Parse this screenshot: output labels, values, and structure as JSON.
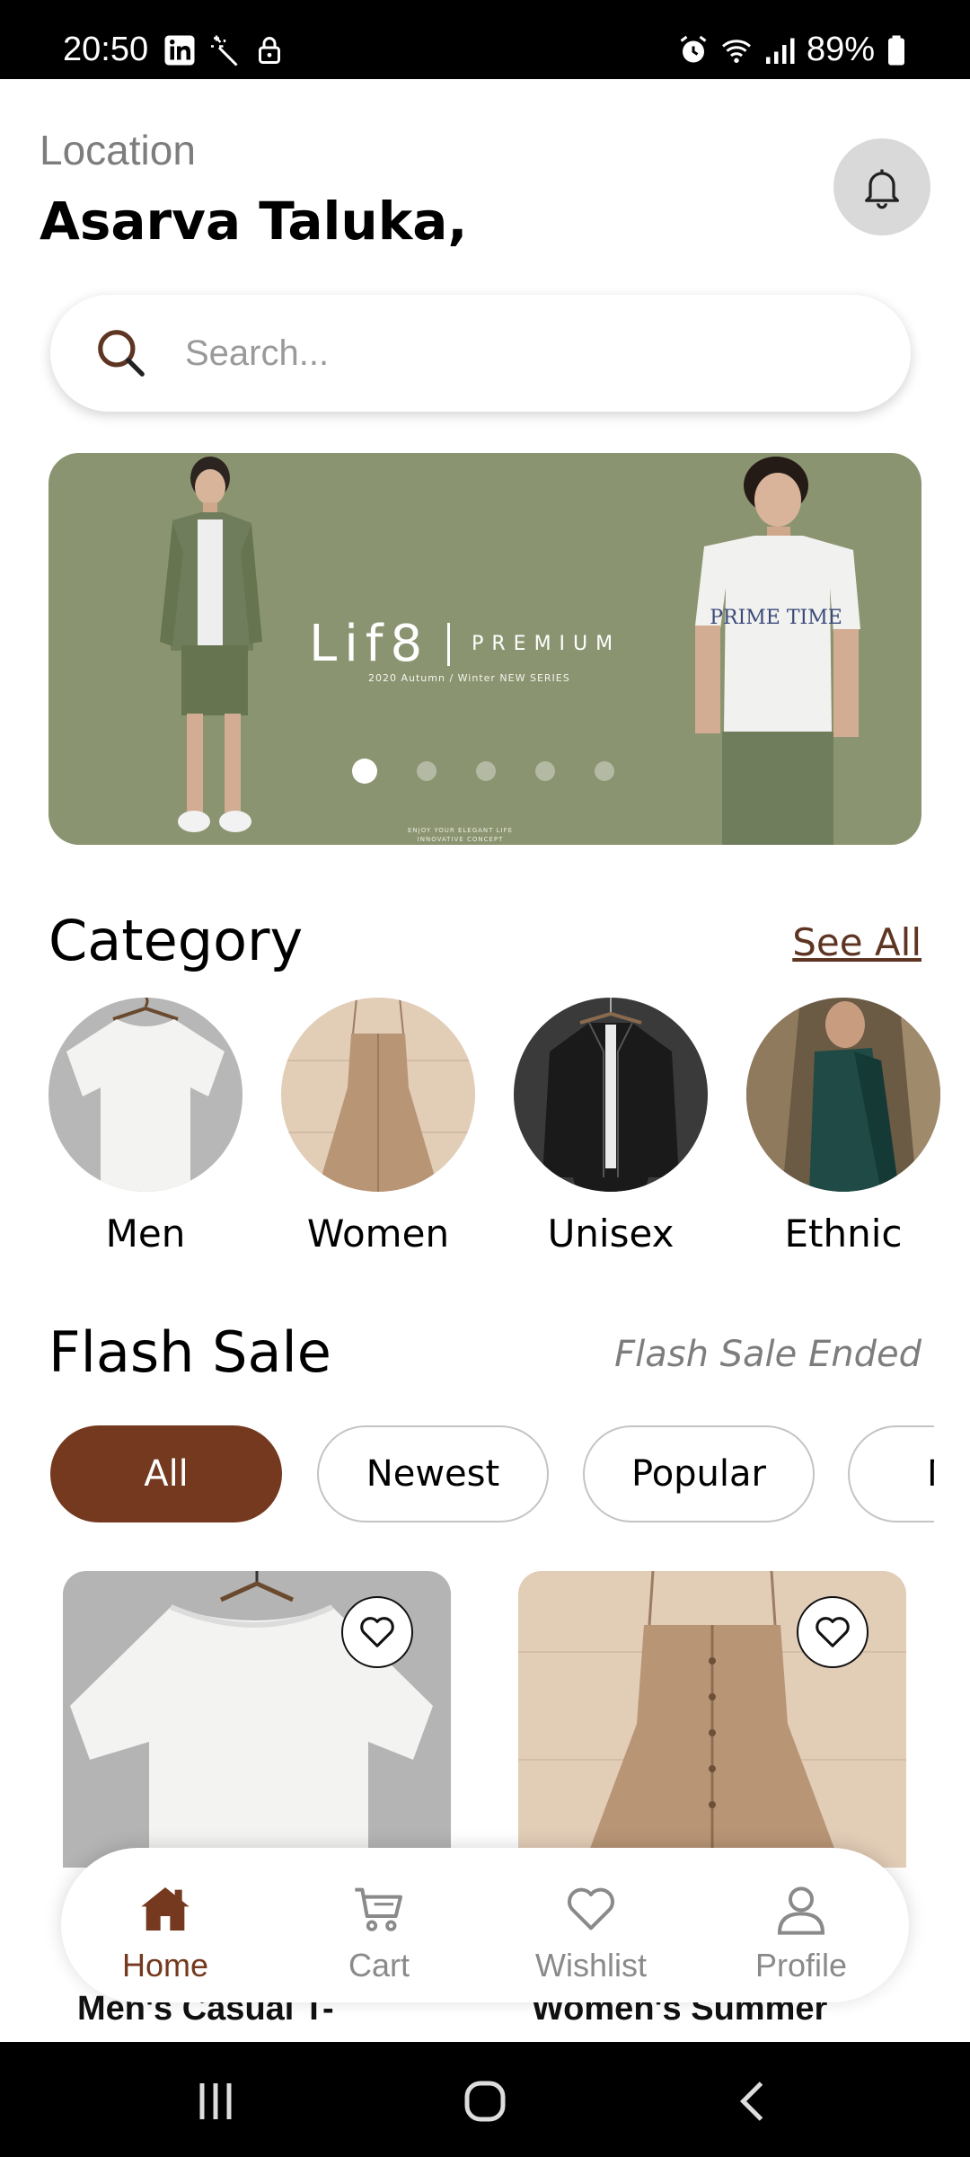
{
  "status_bar": {
    "time": "20:50",
    "battery": "89%",
    "left_icons": [
      "linkedin-icon",
      "magic-wand-icon",
      "lock-icon"
    ],
    "right_icons": [
      "alarm-icon",
      "wifi-icon",
      "signal-icon",
      "battery-icon"
    ]
  },
  "header": {
    "location_label": "Location",
    "location_value": "Asarva Taluka,"
  },
  "search": {
    "placeholder": "Search..."
  },
  "banner": {
    "brand": "Lif8",
    "tagline": "PREMIUM",
    "series": "2020 Autumn / Winter NEW SERIES",
    "footer_line1": "ENJOY YOUR ELEGANT LIFE",
    "footer_line2": "INNOVATIVE CONCEPT",
    "shirt_print": "PRIME TIME",
    "slide_count": 5,
    "active_slide": 1,
    "background_color": "#8b9470"
  },
  "category": {
    "title": "Category",
    "see_all": "See All",
    "items": [
      {
        "label": "Men"
      },
      {
        "label": "Women"
      },
      {
        "label": "Unisex"
      },
      {
        "label": "Ethnic"
      }
    ]
  },
  "flash_sale": {
    "title": "Flash Sale",
    "status": "Flash Sale Ended",
    "filters": [
      "All",
      "Newest",
      "Popular",
      "M"
    ],
    "active_filter": "All"
  },
  "products": [
    {
      "name": "Men's Casual T-"
    },
    {
      "name": "Women's Summer"
    }
  ],
  "bottom_nav": {
    "items": [
      {
        "label": "Home",
        "icon": "home-icon",
        "active": true
      },
      {
        "label": "Cart",
        "icon": "cart-icon",
        "active": false
      },
      {
        "label": "Wishlist",
        "icon": "heart-icon",
        "active": false
      },
      {
        "label": "Profile",
        "icon": "profile-icon",
        "active": false
      }
    ]
  },
  "colors": {
    "accent": "#74391e",
    "link": "#5e3522",
    "muted_text": "#7d7d7d"
  }
}
